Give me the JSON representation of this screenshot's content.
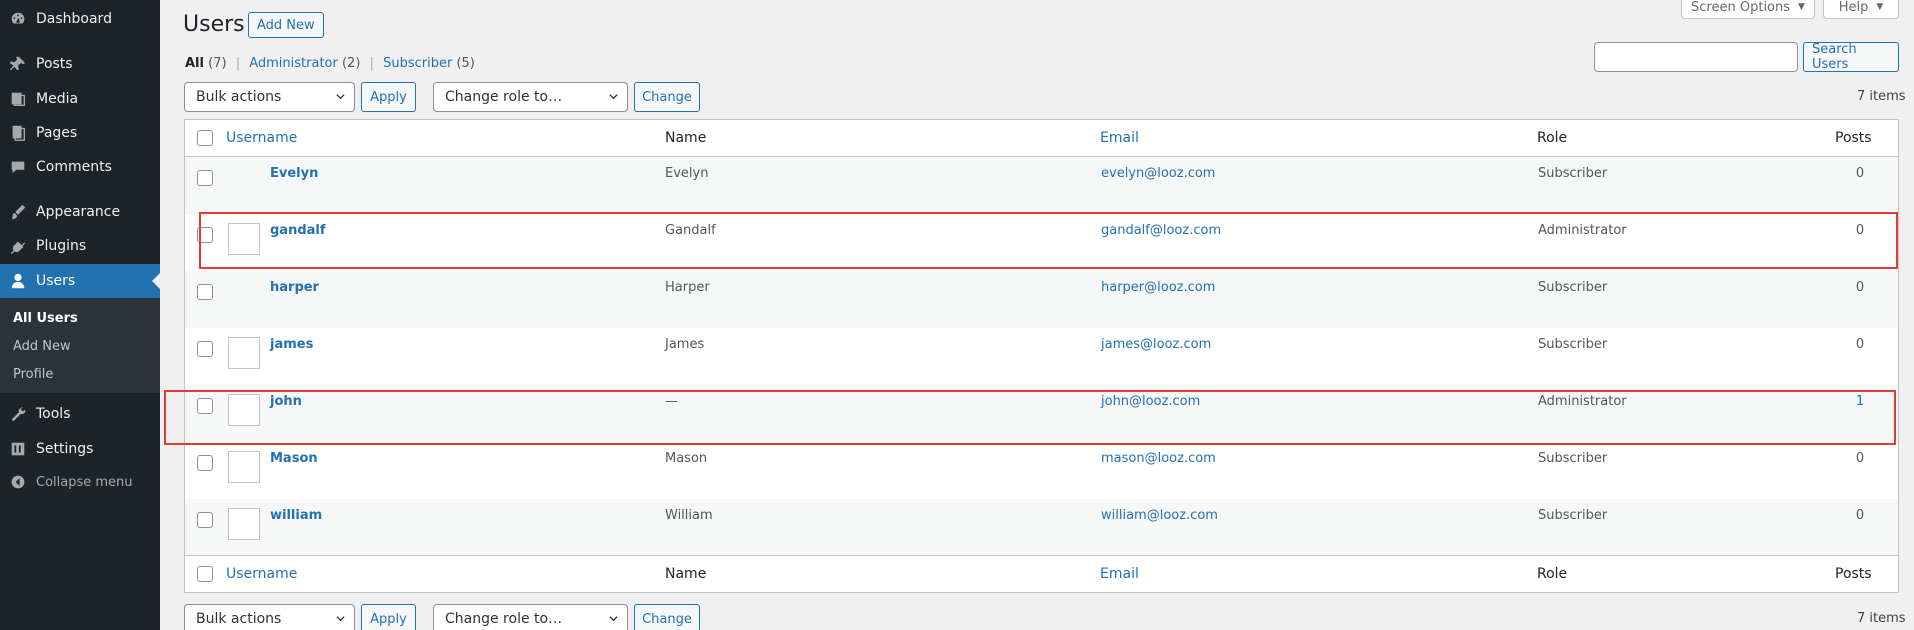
{
  "sidebar": {
    "items": [
      {
        "label": "Dashboard",
        "icon": "dashboard-icon"
      },
      {
        "label": "Posts",
        "icon": "pin-icon"
      },
      {
        "label": "Media",
        "icon": "media-icon"
      },
      {
        "label": "Pages",
        "icon": "pages-icon"
      },
      {
        "label": "Comments",
        "icon": "comment-icon"
      },
      {
        "label": "Appearance",
        "icon": "brush-icon"
      },
      {
        "label": "Plugins",
        "icon": "plugin-icon"
      },
      {
        "label": "Users",
        "icon": "user-icon"
      },
      {
        "label": "Tools",
        "icon": "wrench-icon"
      },
      {
        "label": "Settings",
        "icon": "settings-icon"
      }
    ],
    "submenu": [
      "All Users",
      "Add New",
      "Profile"
    ],
    "collapse_label": "Collapse menu"
  },
  "header": {
    "title": "Users",
    "add_new_label": "Add New",
    "screen_options_label": "Screen Options",
    "help_label": "Help"
  },
  "filters": {
    "all_label": "All",
    "all_count": "(7)",
    "administrator_label": "Administrator",
    "administrator_count": "(2)",
    "subscriber_label": "Subscriber",
    "subscriber_count": "(5)"
  },
  "search": {
    "value": "",
    "button_label": "Search Users"
  },
  "actions": {
    "bulk_actions_value": "Bulk actions",
    "apply_label": "Apply",
    "change_role_value": "Change role to…",
    "change_label": "Change",
    "items_count": "7 items"
  },
  "table": {
    "columns": {
      "username": "Username",
      "name": "Name",
      "email": "Email",
      "role": "Role",
      "posts": "Posts"
    },
    "rows": [
      {
        "username": "Evelyn",
        "name": "Evelyn",
        "email": "evelyn@looz.com",
        "role": "Subscriber",
        "posts": "0"
      },
      {
        "username": "gandalf",
        "name": "Gandalf",
        "email": "gandalf@looz.com",
        "role": "Administrator",
        "posts": "0"
      },
      {
        "username": "harper",
        "name": "Harper",
        "email": "harper@looz.com",
        "role": "Subscriber",
        "posts": "0"
      },
      {
        "username": "james",
        "name": "James",
        "email": "james@looz.com",
        "role": "Subscriber",
        "posts": "0"
      },
      {
        "username": "john",
        "name": "—",
        "email": "john@looz.com",
        "role": "Administrator",
        "posts": "1"
      },
      {
        "username": "Mason",
        "name": "Mason",
        "email": "mason@looz.com",
        "role": "Subscriber",
        "posts": "0"
      },
      {
        "username": "william",
        "name": "William",
        "email": "william@looz.com",
        "role": "Subscriber",
        "posts": "0"
      }
    ]
  },
  "colors": {
    "accent": "#2271b1",
    "sidebar_bg": "#1d2327",
    "highlight": "#e03a3a"
  }
}
